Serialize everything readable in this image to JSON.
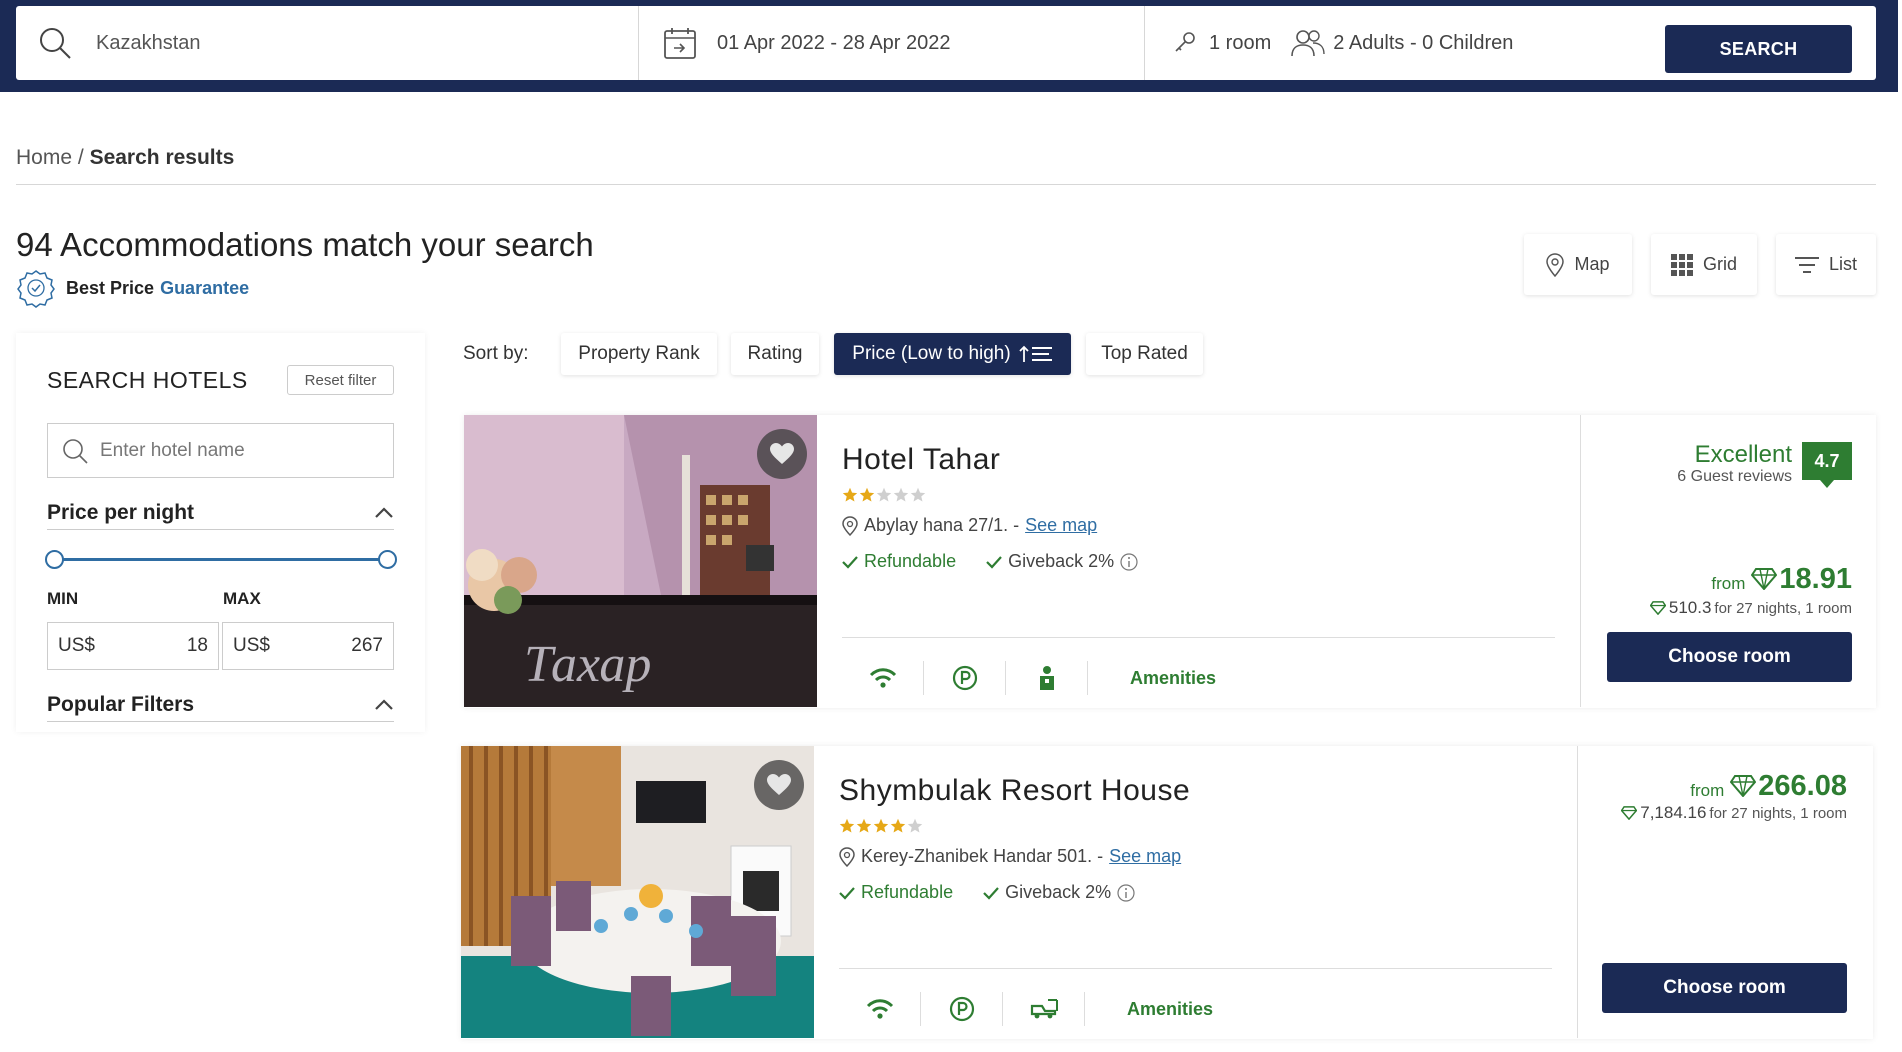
{
  "search_bar": {
    "destination": "Kazakhstan",
    "dates": "01 Apr 2022 - 28 Apr 2022",
    "rooms": "1 room",
    "guests": "2 Adults - 0 Children",
    "search_label": "SEARCH"
  },
  "breadcrumb": {
    "home": "Home",
    "separator": "/",
    "current": "Search results"
  },
  "results": {
    "title": "94 Accommodations match your search",
    "best_price": "Best Price",
    "guarantee": "Guarantee"
  },
  "views": {
    "map": "Map",
    "grid": "Grid",
    "list": "List"
  },
  "sidebar": {
    "title": "SEARCH HOTELS",
    "reset_label": "Reset filter",
    "hotel_placeholder": "Enter hotel name",
    "price_section": "Price per night",
    "min_label": "MIN",
    "max_label": "MAX",
    "currency": "US$",
    "min_value": "18",
    "max_value": "267",
    "popular_section": "Popular Filters"
  },
  "sort": {
    "label": "Sort by:",
    "options": [
      "Property Rank",
      "Rating",
      "Price (Low to high)",
      "Top Rated"
    ],
    "active": "Price (Low to high)"
  },
  "hotels": [
    {
      "name": "Hotel Tahar",
      "stars": 2,
      "address": "Abylay hana 27/1. -",
      "see_map": "See map",
      "refundable": "Refundable",
      "giveback": "Giveback 2%",
      "amenities_label": "Amenities",
      "review_word": "Excellent",
      "review_count": "6 Guest reviews",
      "score": "4.7",
      "from_label": "from",
      "price": "18.91",
      "total": "510.3",
      "total_note": "for 27 nights, 1 room",
      "choose_label": "Choose room",
      "image_text": "Тахар"
    },
    {
      "name": "Shymbulak Resort House",
      "stars": 4,
      "address": "Kerey-Zhanibek Handar 501. -",
      "see_map": "See map",
      "refundable": "Refundable",
      "giveback": "Giveback 2%",
      "amenities_label": "Amenities",
      "from_label": "from",
      "price": "266.08",
      "total": "7,184.16",
      "total_note": "for 27 nights, 1 room",
      "choose_label": "Choose room"
    }
  ],
  "colors": {
    "navy": "#1b2a55",
    "green": "#2e7d32",
    "link": "#2f6da3",
    "star": "#e6a817"
  }
}
